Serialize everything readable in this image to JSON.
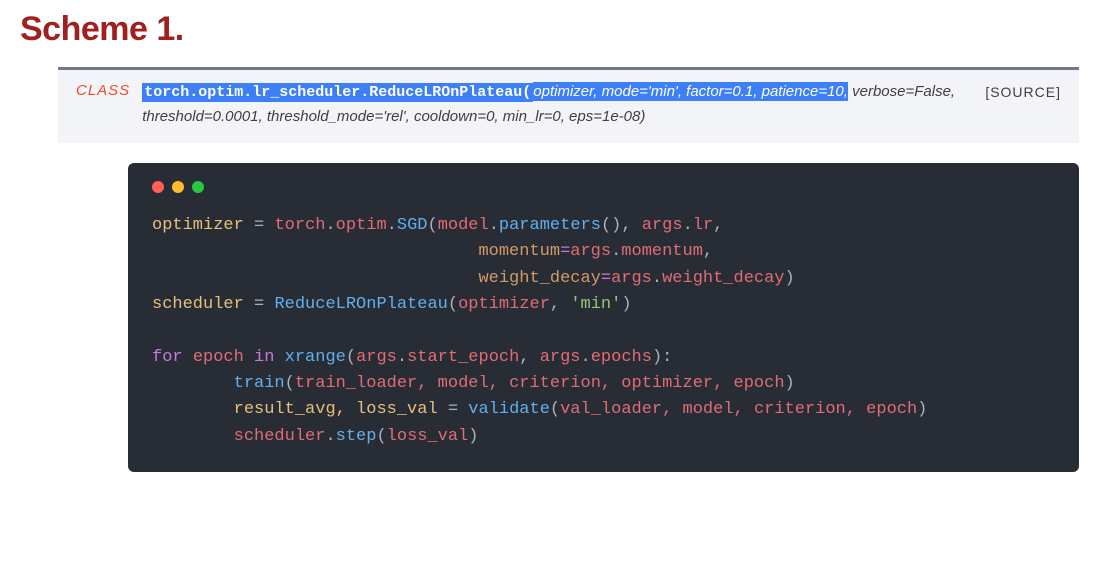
{
  "title": "Scheme 1.",
  "doc": {
    "class_label": "CLASS",
    "qualified_name": "torch.optim.lr_scheduler.ReduceLROnPlateau(",
    "args_highlighted": "optimizer, mode='min', factor=0.1, patience=10",
    "args_trailing_hl": ",",
    "args_rest": "verbose=False, threshold=0.0001, threshold_mode='rel', cooldown=0, min_lr=0, eps=1e-08)",
    "source_label": "[SOURCE]"
  },
  "code": {
    "dots": [
      "r",
      "y",
      "g"
    ],
    "l1": {
      "lhs": "optimizer",
      "eq": " = ",
      "obj": "torch",
      "d1": ".",
      "m1": "optim",
      "d2": ".",
      "fn": "SGD",
      "op": "(",
      "arg1": "model",
      "d3": ".",
      "call": "parameters",
      "cp": "()",
      "c1": ", ",
      "arg2": "args",
      "d4": ".",
      "attr": "lr",
      "c2": ","
    },
    "l2": {
      "pad": "                                ",
      "kw": "momentum",
      "eq": "=",
      "obj": "args",
      "d": ".",
      "attr": "momentum",
      "c": ","
    },
    "l3": {
      "pad": "                                ",
      "kw": "weight_decay",
      "eq": "=",
      "obj": "args",
      "d": ".",
      "attr": "weight_decay",
      "cp": ")"
    },
    "l4": {
      "lhs": "scheduler",
      "eq": " = ",
      "fn": "ReduceLROnPlateau",
      "op": "(",
      "arg": "optimizer",
      "c": ", ",
      "str": "'min'",
      "cp": ")"
    },
    "blank": " ",
    "l5": {
      "for": "for",
      "sp1": " ",
      "var": "epoch",
      "sp2": " ",
      "in": "in",
      "sp3": " ",
      "fn": "xrange",
      "op": "(",
      "o1": "args",
      "d1": ".",
      "a1": "start_epoch",
      "c": ", ",
      "o2": "args",
      "d2": ".",
      "a2": "epochs",
      "cp": "):"
    },
    "l6": {
      "pad": "        ",
      "fn": "train",
      "op": "(",
      "inner": "train_loader, model, criterion, optimizer, epoch",
      "cp": ")"
    },
    "l7": {
      "pad": "        ",
      "lhs": "result_avg, loss_val",
      "eq": " = ",
      "fn": "validate",
      "op": "(",
      "inner": "val_loader, model, criterion, epoch",
      "cp": ")"
    },
    "l8": {
      "pad": "        ",
      "obj": "scheduler",
      "d": ".",
      "fn": "step",
      "op": "(",
      "arg": "loss_val",
      "cp": ")"
    }
  }
}
